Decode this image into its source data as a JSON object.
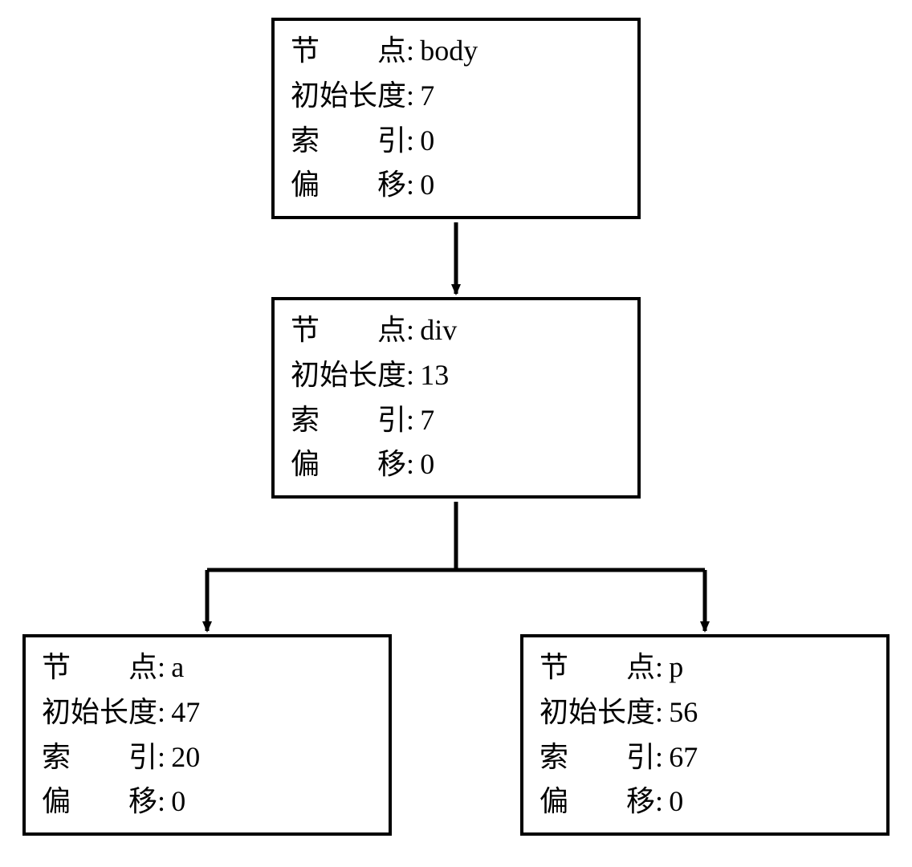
{
  "labels": {
    "node": "节点",
    "initial_length": "初始长度",
    "index": "索引",
    "offset": "偏移"
  },
  "colon": ":",
  "nodes": {
    "body": {
      "name": "body",
      "initial_length": "7",
      "index": "0",
      "offset": "0"
    },
    "div": {
      "name": "div",
      "initial_length": "13",
      "index": "7",
      "offset": "0"
    },
    "a": {
      "name": "a",
      "initial_length": "47",
      "index": "20",
      "offset": "0"
    },
    "p": {
      "name": "p",
      "initial_length": "56",
      "index": "67",
      "offset": "0"
    }
  }
}
